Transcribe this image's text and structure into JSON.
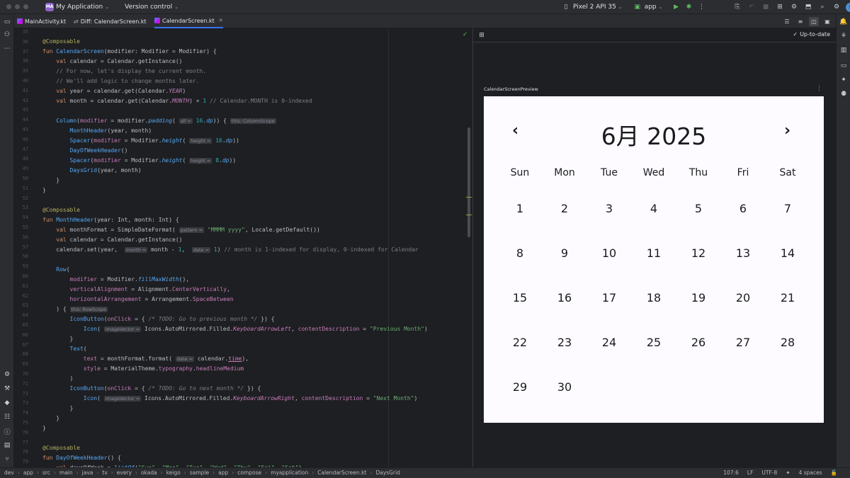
{
  "titlebar": {
    "project_badge": "MA",
    "project_name": "My Application",
    "vcs": "Version control",
    "device": "Pixel 2 API 35",
    "run_config": "app"
  },
  "tabs": [
    {
      "label": "MainActivity.kt"
    },
    {
      "label": "Diff: CalendarScreen.kt"
    },
    {
      "label": "CalendarScreen.kt"
    }
  ],
  "editor": {
    "line_numbers": [
      "35",
      "36",
      "37",
      "38",
      "39",
      "40",
      "41",
      "42",
      "43",
      "44",
      "45",
      "46",
      "47",
      "48",
      "49",
      "50",
      "51",
      "52",
      "53",
      "54",
      "55",
      "56",
      "57",
      "58",
      "59",
      "60",
      "61",
      "62",
      "63",
      "64",
      "65",
      "66",
      "67",
      "68",
      "69",
      "70",
      "71",
      "72",
      "73",
      "74",
      "75",
      "76",
      "77",
      "78",
      "79"
    ],
    "hints": {
      "all": "all =",
      "column_scope": "this: ColumnScope",
      "height": "height =",
      "pattern": "pattern =",
      "month": "month =",
      "date": "date =",
      "row_scope": "this: RowScope",
      "image_vector": "imageVector =",
      "date2": "date ="
    }
  },
  "preview": {
    "status": "Up-to-date",
    "label": "CalendarScreenPreview",
    "calendar": {
      "title": "6月 2025",
      "prev": "‹",
      "next": "›",
      "weekdays": [
        "Sun",
        "Mon",
        "Tue",
        "Wed",
        "Thu",
        "Fri",
        "Sat"
      ],
      "weeks": [
        [
          "1",
          "2",
          "3",
          "4",
          "5",
          "6",
          "7"
        ],
        [
          "8",
          "9",
          "10",
          "11",
          "12",
          "13",
          "14"
        ],
        [
          "15",
          "16",
          "17",
          "18",
          "19",
          "20",
          "21"
        ],
        [
          "22",
          "23",
          "24",
          "25",
          "26",
          "27",
          "28"
        ],
        [
          "29",
          "30",
          "",
          "",
          "",
          "",
          ""
        ]
      ]
    }
  },
  "statusbar": {
    "breadcrumbs": [
      "dev",
      "app",
      "src",
      "main",
      "java",
      "tv",
      "every",
      "okada",
      "keigo",
      "sample",
      "app",
      "compose",
      "myapplication",
      "CalendarScreen.kt",
      "DaysGrid"
    ],
    "position": "107:6",
    "line_sep": "LF",
    "encoding": "UTF-8",
    "indent": "4 spaces"
  }
}
